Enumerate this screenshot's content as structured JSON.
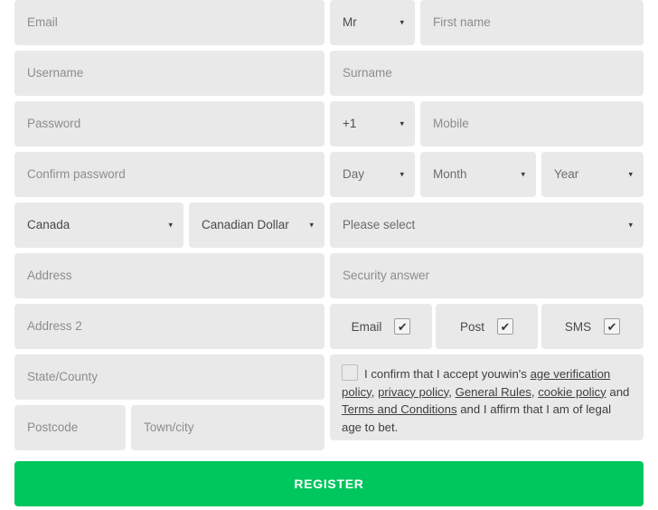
{
  "form": {
    "left_column": {
      "email": {
        "placeholder": "Email"
      },
      "username": {
        "placeholder": "Username"
      },
      "password": {
        "placeholder": "Password"
      },
      "confirm_password": {
        "placeholder": "Confirm password"
      },
      "country": {
        "value": "Canada"
      },
      "currency": {
        "value": "Canadian Dollar"
      },
      "address": {
        "placeholder": "Address"
      },
      "address2": {
        "placeholder": "Address 2"
      },
      "state_county": {
        "placeholder": "State/County"
      },
      "postcode": {
        "placeholder": "Postcode"
      },
      "town_city": {
        "placeholder": "Town/city"
      }
    },
    "right_column": {
      "title": {
        "value": "Mr"
      },
      "first_name": {
        "placeholder": "First name"
      },
      "surname": {
        "placeholder": "Surname"
      },
      "dial_code": {
        "value": "+1"
      },
      "mobile": {
        "placeholder": "Mobile"
      },
      "day": {
        "value": "Day"
      },
      "month": {
        "value": "Month"
      },
      "year": {
        "value": "Year"
      },
      "security_question": {
        "value": "Please select"
      },
      "security_answer": {
        "placeholder": "Security answer"
      }
    },
    "contact_preferences": [
      {
        "label": "Email",
        "checked": true,
        "mark": "✔"
      },
      {
        "label": "Post",
        "checked": true,
        "mark": "✔"
      },
      {
        "label": "SMS",
        "checked": true,
        "mark": "✔"
      }
    ],
    "terms": {
      "checked": false,
      "text_1": "I confirm that I accept youwin's ",
      "link_age": "age verification policy",
      "sep_1": ", ",
      "link_privacy": "privacy policy",
      "sep_2": ", ",
      "link_rules": "General Rules",
      "sep_3": ", ",
      "link_cookie": "cookie policy",
      "sep_4": " and ",
      "link_terms": "Terms and Conditions",
      "text_2": " and I affirm that I am of legal age to bet."
    },
    "submit": {
      "label": "REGISTER"
    },
    "icons": {
      "caret": "▾"
    },
    "colors": {
      "field_background": "#e9e9e9",
      "placeholder_text": "#8d8d8d",
      "value_text": "#4a4a4a",
      "submit_green": "#00c65e",
      "submit_text": "#ffffff"
    }
  }
}
